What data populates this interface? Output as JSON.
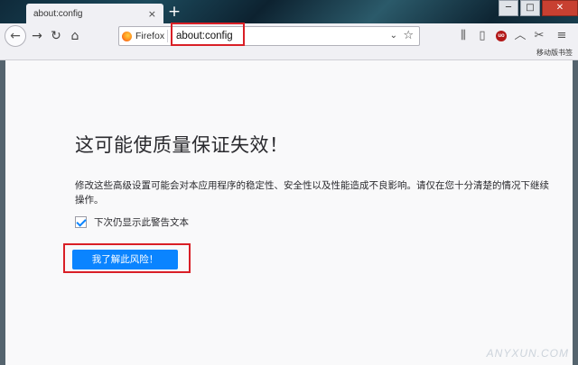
{
  "tab": {
    "title": "about:config",
    "close_glyph": "×"
  },
  "newtab_glyph": "+",
  "window_controls": {
    "minimize": "─",
    "maximize": "□",
    "close": "✕"
  },
  "nav": {
    "back_glyph": "←",
    "forward_glyph": "→",
    "reload_glyph": "↻",
    "home_glyph": "⌂"
  },
  "urlbar": {
    "identity_label": "Firefox",
    "url": "about:config",
    "dropdown_glyph": "⌄",
    "bookmark_glyph": "☆"
  },
  "toolbar": {
    "library_glyph": "⫼",
    "sidebar_glyph": "▯",
    "ublock_label": "uo",
    "sync_glyph": "︿",
    "screenshot_glyph": "✂",
    "menu_glyph": "≡"
  },
  "bookmarks": {
    "mobile_label": "移动版书签"
  },
  "warning": {
    "title": "这可能使质量保证失效！",
    "description": "修改这些高级设置可能会对本应用程序的稳定性、安全性以及性能造成不良影响。请仅在您十分清楚的情况下继续操作。",
    "checkbox_label": "下次仍显示此警告文本",
    "checkbox_checked": true,
    "accept_button": "我了解此风险！"
  },
  "watermark": "ANYXUN.COM",
  "colors": {
    "accent": "#0a84ff",
    "highlight": "#d91f26",
    "content_bg": "#f9f9fa",
    "toolbar_bg": "#f0f0f4"
  }
}
